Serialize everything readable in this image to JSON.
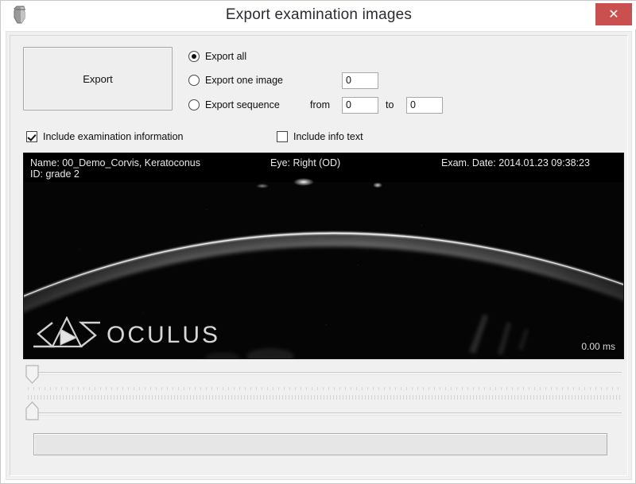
{
  "window": {
    "title": "Export examination images",
    "icon": "device-icon",
    "close_label": "✕"
  },
  "toolbar": {
    "export_label": "Export"
  },
  "export_options": {
    "group_name": "export-mode",
    "items": [
      {
        "label": "Export all",
        "selected": true,
        "name": "radio-export-all"
      },
      {
        "label": "Export one image",
        "selected": false,
        "name": "radio-export-one-image"
      },
      {
        "label": "Export sequence",
        "selected": false,
        "name": "radio-export-sequence"
      }
    ],
    "one_image_value": "0",
    "from_label": "from",
    "from_value": "0",
    "to_label": "to",
    "to_value": "0"
  },
  "checkboxes": [
    {
      "label": "Include examination information",
      "checked": true,
      "name": "checkbox-include-exam-info"
    },
    {
      "label": "Include info text",
      "checked": false,
      "name": "checkbox-include-info-text"
    }
  ],
  "preview": {
    "name_line": "Name: 00_Demo_Corvis, Keratoconus",
    "id_line": "ID: grade 2",
    "eye_line": "Eye: Right (OD)",
    "date_line": "Exam. Date: 2014.01.23 09:38:23",
    "time_readout": "0.00 ms",
    "logo_text": "OCULUS",
    "background_color": "#050505",
    "cornea_color": "#e8e8e8"
  },
  "sliders": {
    "top": {
      "name": "frame-slider",
      "value": 0
    },
    "bottom": {
      "name": "sequence-slider",
      "value": 0
    }
  },
  "progress": {
    "value": 0,
    "accent_color": "#3aa33a"
  }
}
